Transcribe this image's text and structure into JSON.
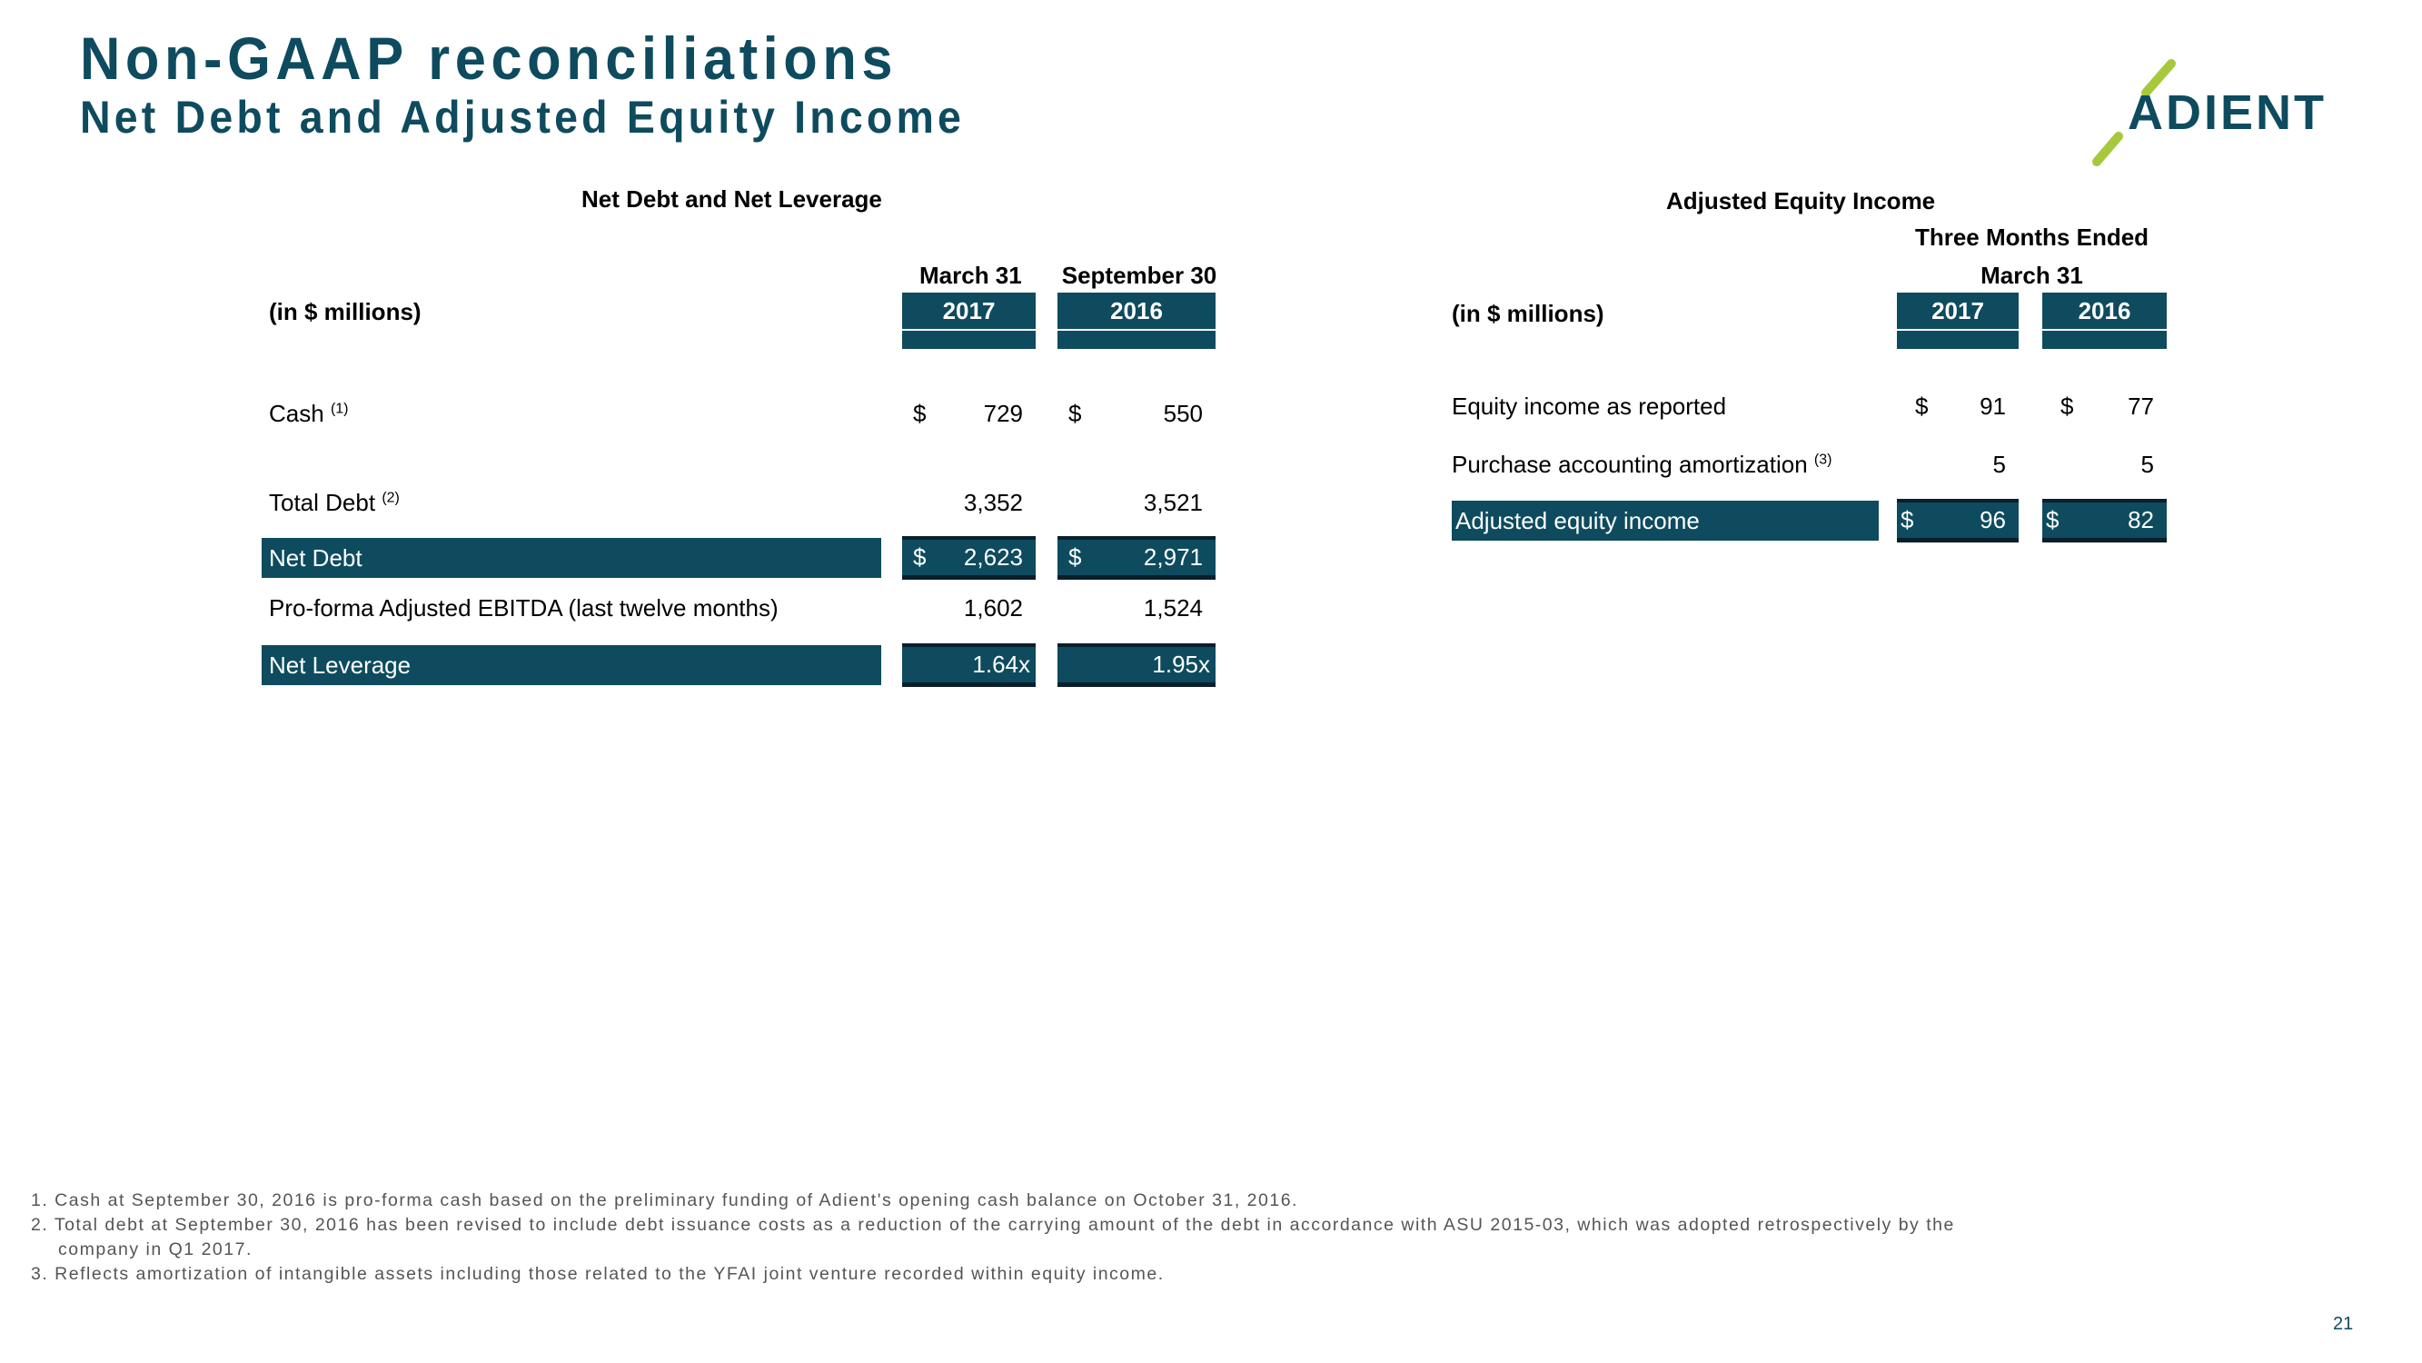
{
  "header": {
    "title": "Non-GAAP reconciliations",
    "subtitle": "Net Debt and Adjusted Equity Income",
    "logo_text": "ADIENT"
  },
  "colors": {
    "brand_teal": "#0e4b5e",
    "brand_green": "#a8c83c"
  },
  "net_debt_table": {
    "caption": "Net Debt and Net Leverage",
    "units_label": "(in $ millions)",
    "columns": [
      {
        "period": "March 31",
        "year": "2017"
      },
      {
        "period": "September 30",
        "year": "2016"
      }
    ],
    "rows": [
      {
        "label": "Cash",
        "footnote": "(1)",
        "values": [
          "729",
          "550"
        ],
        "currency": true,
        "highlight": false
      },
      {
        "label": "Total Debt",
        "footnote": "(2)",
        "values": [
          "3,352",
          "3,521"
        ],
        "currency": false,
        "highlight": false
      },
      {
        "label": "Net Debt",
        "footnote": "",
        "values": [
          "2,623",
          "2,971"
        ],
        "currency": true,
        "highlight": true
      },
      {
        "label": "Pro-forma Adjusted EBITDA (last twelve months)",
        "footnote": "",
        "values": [
          "1,602",
          "1,524"
        ],
        "currency": false,
        "highlight": false
      },
      {
        "label": "Net Leverage",
        "footnote": "",
        "values": [
          "1.64x",
          "1.95x"
        ],
        "currency": false,
        "highlight": true
      }
    ],
    "currency_symbol": "$"
  },
  "equity_table": {
    "caption": "Adjusted Equity Income",
    "period_line1": "Three Months Ended",
    "period_line2": "March 31",
    "units_label": "(in $ millions)",
    "columns": [
      {
        "year": "2017"
      },
      {
        "year": "2016"
      }
    ],
    "rows": [
      {
        "label": "Equity income as reported",
        "footnote": "",
        "values": [
          "91",
          "77"
        ],
        "currency": true,
        "highlight": false
      },
      {
        "label": "Purchase accounting amortization",
        "footnote": "(3)",
        "values": [
          "5",
          "5"
        ],
        "currency": false,
        "highlight": false
      },
      {
        "label": "Adjusted equity income",
        "footnote": "",
        "values": [
          "96",
          "82"
        ],
        "currency": true,
        "highlight": true
      }
    ],
    "currency_symbol": "$"
  },
  "footnotes": [
    "1. Cash at September 30, 2016 is pro-forma cash based on the preliminary funding of Adient's opening cash balance on October 31, 2016.",
    "2. Total debt at September 30, 2016 has been revised to include debt issuance costs as a reduction of the carrying amount of the debt in accordance with ASU 2015-03, which was adopted retrospectively by the",
    "company in Q1 2017.",
    "3. Reflects amortization of intangible assets including those related to the YFAI joint venture recorded within equity income."
  ],
  "page_number": "21"
}
